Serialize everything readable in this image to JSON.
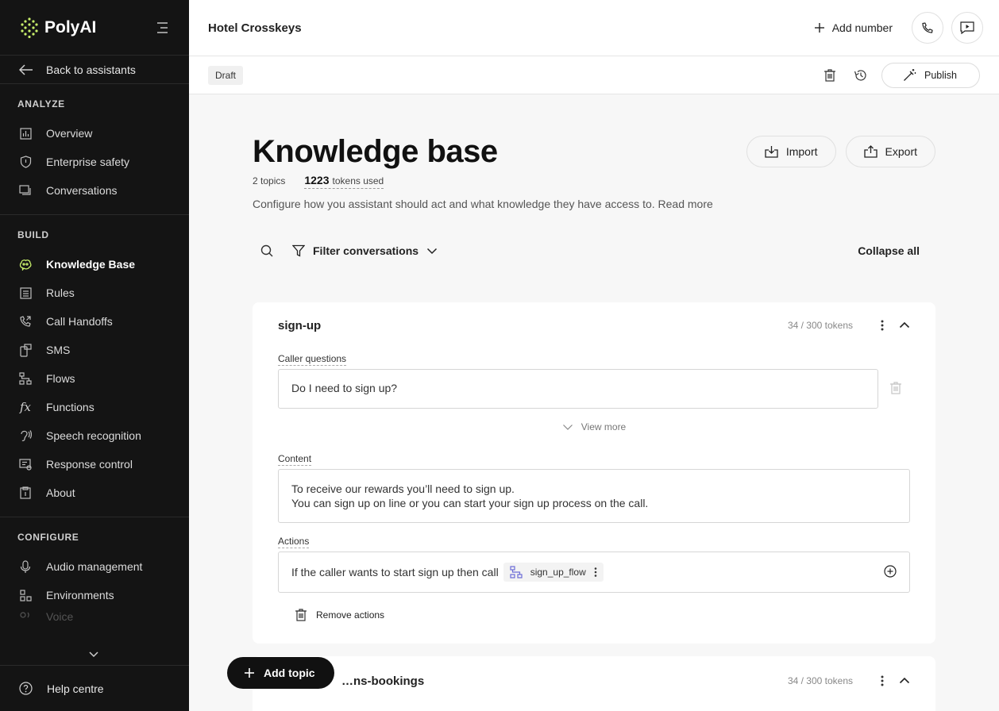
{
  "sidebar": {
    "logo_text": "PolyAI",
    "back_label": "Back to assistants",
    "sections": [
      {
        "title": "ANALYZE",
        "items": [
          {
            "label": "Overview",
            "icon": "chart-icon"
          },
          {
            "label": "Enterprise safety",
            "icon": "shield-icon"
          },
          {
            "label": "Conversations",
            "icon": "chat-icon"
          }
        ]
      },
      {
        "title": "BUILD",
        "items": [
          {
            "label": "Knowledge Base",
            "icon": "brain-icon",
            "active": true
          },
          {
            "label": "Rules",
            "icon": "list-icon"
          },
          {
            "label": "Call Handoffs",
            "icon": "phone-forward-icon"
          },
          {
            "label": "SMS",
            "icon": "sms-icon"
          },
          {
            "label": "Flows",
            "icon": "flow-icon"
          },
          {
            "label": "Functions",
            "icon": "function-icon"
          },
          {
            "label": "Speech recognition",
            "icon": "ear-icon"
          },
          {
            "label": "Response control",
            "icon": "response-icon"
          },
          {
            "label": "About",
            "icon": "clipboard-icon"
          }
        ]
      },
      {
        "title": "CONFIGURE",
        "items": [
          {
            "label": "Audio management",
            "icon": "mic-icon"
          },
          {
            "label": "Environments",
            "icon": "grid-icon"
          },
          {
            "label": "Voice",
            "icon": "voice-icon"
          }
        ]
      }
    ],
    "help_label": "Help centre"
  },
  "topbar": {
    "project_title": "Hotel Crosskeys",
    "add_number_label": "Add number"
  },
  "subbar": {
    "status_badge": "Draft",
    "publish_label": "Publish"
  },
  "main": {
    "title": "Knowledge base",
    "topics_count": "2 topics",
    "tokens_used_value": "1223",
    "tokens_used_label": "tokens used",
    "description": "Configure how you assistant should act and what knowledge they have access to. Read more",
    "import_label": "Import",
    "export_label": "Export",
    "filter_label": "Filter conversations",
    "collapse_all_label": "Collapse all",
    "add_topic_label": "Add topic"
  },
  "topics": [
    {
      "name": "sign-up",
      "tokens": "34 / 300 tokens",
      "caller_questions_label": "Caller questions",
      "question": "Do I need to sign up?",
      "view_more_label": "View more",
      "content_label": "Content",
      "content_line1": "To receive our rewards you’ll need to sign up.",
      "content_line2": "You can sign up on line or you can start your sign up process on the call.",
      "actions_label": "Actions",
      "action_text": "If the caller wants to start sign up then call",
      "action_flow": "sign_up_flow",
      "remove_actions_label": "Remove actions"
    },
    {
      "name": "…ns-bookings",
      "tokens": "34 / 300 tokens"
    }
  ]
}
